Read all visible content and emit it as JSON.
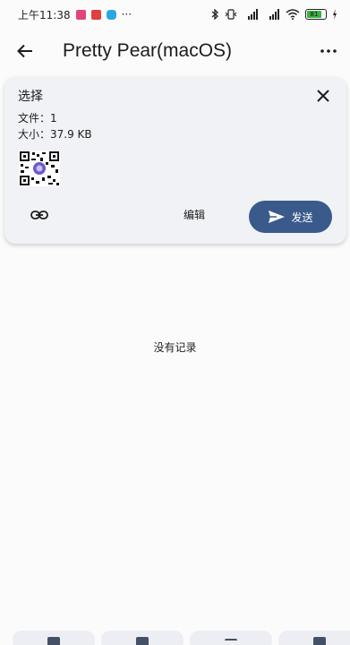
{
  "status_bar": {
    "time": "上午11:38",
    "dots": "···",
    "battery_level": 0.8,
    "battery_text": "81"
  },
  "app_bar": {
    "title": "Pretty Pear(macOS)",
    "back_icon": "arrow-left-icon",
    "more_icon": "more-horizontal-icon"
  },
  "selection": {
    "title": "选择",
    "files_text": "文件：1",
    "size_text": "大小：37.9 KB",
    "edit_label": "编辑",
    "send_label": "发送"
  },
  "history": {
    "empty_text": "没有记录"
  },
  "colors": {
    "send_button": "#3a5a8c",
    "card_bg": "#f1f2f6",
    "page_bg": "#fbfbfb"
  }
}
